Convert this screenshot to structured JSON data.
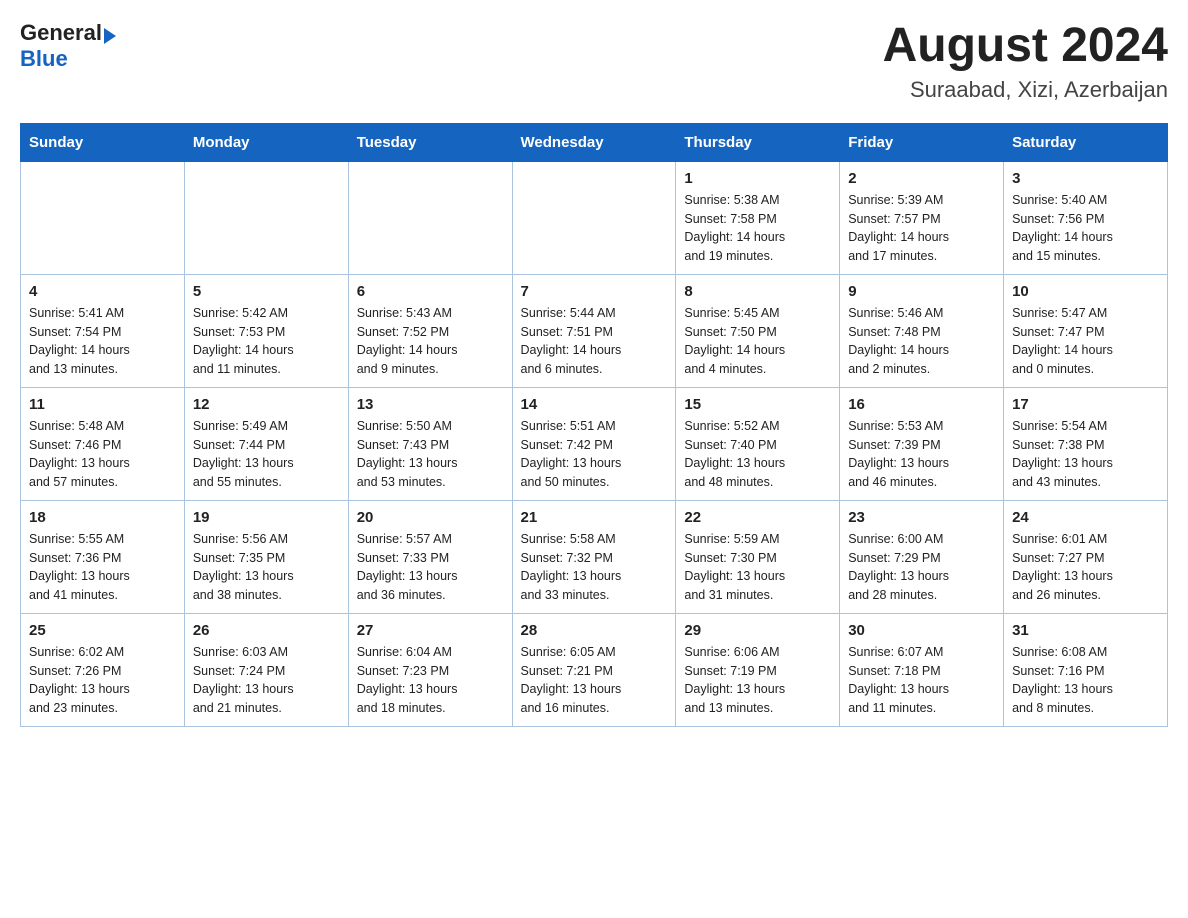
{
  "header": {
    "logo_text_general": "General",
    "logo_text_blue": "Blue",
    "month_year": "August 2024",
    "location": "Suraabad, Xizi, Azerbaijan"
  },
  "weekdays": [
    "Sunday",
    "Monday",
    "Tuesday",
    "Wednesday",
    "Thursday",
    "Friday",
    "Saturday"
  ],
  "weeks": [
    [
      {
        "day": "",
        "info": ""
      },
      {
        "day": "",
        "info": ""
      },
      {
        "day": "",
        "info": ""
      },
      {
        "day": "",
        "info": ""
      },
      {
        "day": "1",
        "info": "Sunrise: 5:38 AM\nSunset: 7:58 PM\nDaylight: 14 hours\nand 19 minutes."
      },
      {
        "day": "2",
        "info": "Sunrise: 5:39 AM\nSunset: 7:57 PM\nDaylight: 14 hours\nand 17 minutes."
      },
      {
        "day": "3",
        "info": "Sunrise: 5:40 AM\nSunset: 7:56 PM\nDaylight: 14 hours\nand 15 minutes."
      }
    ],
    [
      {
        "day": "4",
        "info": "Sunrise: 5:41 AM\nSunset: 7:54 PM\nDaylight: 14 hours\nand 13 minutes."
      },
      {
        "day": "5",
        "info": "Sunrise: 5:42 AM\nSunset: 7:53 PM\nDaylight: 14 hours\nand 11 minutes."
      },
      {
        "day": "6",
        "info": "Sunrise: 5:43 AM\nSunset: 7:52 PM\nDaylight: 14 hours\nand 9 minutes."
      },
      {
        "day": "7",
        "info": "Sunrise: 5:44 AM\nSunset: 7:51 PM\nDaylight: 14 hours\nand 6 minutes."
      },
      {
        "day": "8",
        "info": "Sunrise: 5:45 AM\nSunset: 7:50 PM\nDaylight: 14 hours\nand 4 minutes."
      },
      {
        "day": "9",
        "info": "Sunrise: 5:46 AM\nSunset: 7:48 PM\nDaylight: 14 hours\nand 2 minutes."
      },
      {
        "day": "10",
        "info": "Sunrise: 5:47 AM\nSunset: 7:47 PM\nDaylight: 14 hours\nand 0 minutes."
      }
    ],
    [
      {
        "day": "11",
        "info": "Sunrise: 5:48 AM\nSunset: 7:46 PM\nDaylight: 13 hours\nand 57 minutes."
      },
      {
        "day": "12",
        "info": "Sunrise: 5:49 AM\nSunset: 7:44 PM\nDaylight: 13 hours\nand 55 minutes."
      },
      {
        "day": "13",
        "info": "Sunrise: 5:50 AM\nSunset: 7:43 PM\nDaylight: 13 hours\nand 53 minutes."
      },
      {
        "day": "14",
        "info": "Sunrise: 5:51 AM\nSunset: 7:42 PM\nDaylight: 13 hours\nand 50 minutes."
      },
      {
        "day": "15",
        "info": "Sunrise: 5:52 AM\nSunset: 7:40 PM\nDaylight: 13 hours\nand 48 minutes."
      },
      {
        "day": "16",
        "info": "Sunrise: 5:53 AM\nSunset: 7:39 PM\nDaylight: 13 hours\nand 46 minutes."
      },
      {
        "day": "17",
        "info": "Sunrise: 5:54 AM\nSunset: 7:38 PM\nDaylight: 13 hours\nand 43 minutes."
      }
    ],
    [
      {
        "day": "18",
        "info": "Sunrise: 5:55 AM\nSunset: 7:36 PM\nDaylight: 13 hours\nand 41 minutes."
      },
      {
        "day": "19",
        "info": "Sunrise: 5:56 AM\nSunset: 7:35 PM\nDaylight: 13 hours\nand 38 minutes."
      },
      {
        "day": "20",
        "info": "Sunrise: 5:57 AM\nSunset: 7:33 PM\nDaylight: 13 hours\nand 36 minutes."
      },
      {
        "day": "21",
        "info": "Sunrise: 5:58 AM\nSunset: 7:32 PM\nDaylight: 13 hours\nand 33 minutes."
      },
      {
        "day": "22",
        "info": "Sunrise: 5:59 AM\nSunset: 7:30 PM\nDaylight: 13 hours\nand 31 minutes."
      },
      {
        "day": "23",
        "info": "Sunrise: 6:00 AM\nSunset: 7:29 PM\nDaylight: 13 hours\nand 28 minutes."
      },
      {
        "day": "24",
        "info": "Sunrise: 6:01 AM\nSunset: 7:27 PM\nDaylight: 13 hours\nand 26 minutes."
      }
    ],
    [
      {
        "day": "25",
        "info": "Sunrise: 6:02 AM\nSunset: 7:26 PM\nDaylight: 13 hours\nand 23 minutes."
      },
      {
        "day": "26",
        "info": "Sunrise: 6:03 AM\nSunset: 7:24 PM\nDaylight: 13 hours\nand 21 minutes."
      },
      {
        "day": "27",
        "info": "Sunrise: 6:04 AM\nSunset: 7:23 PM\nDaylight: 13 hours\nand 18 minutes."
      },
      {
        "day": "28",
        "info": "Sunrise: 6:05 AM\nSunset: 7:21 PM\nDaylight: 13 hours\nand 16 minutes."
      },
      {
        "day": "29",
        "info": "Sunrise: 6:06 AM\nSunset: 7:19 PM\nDaylight: 13 hours\nand 13 minutes."
      },
      {
        "day": "30",
        "info": "Sunrise: 6:07 AM\nSunset: 7:18 PM\nDaylight: 13 hours\nand 11 minutes."
      },
      {
        "day": "31",
        "info": "Sunrise: 6:08 AM\nSunset: 7:16 PM\nDaylight: 13 hours\nand 8 minutes."
      }
    ]
  ]
}
